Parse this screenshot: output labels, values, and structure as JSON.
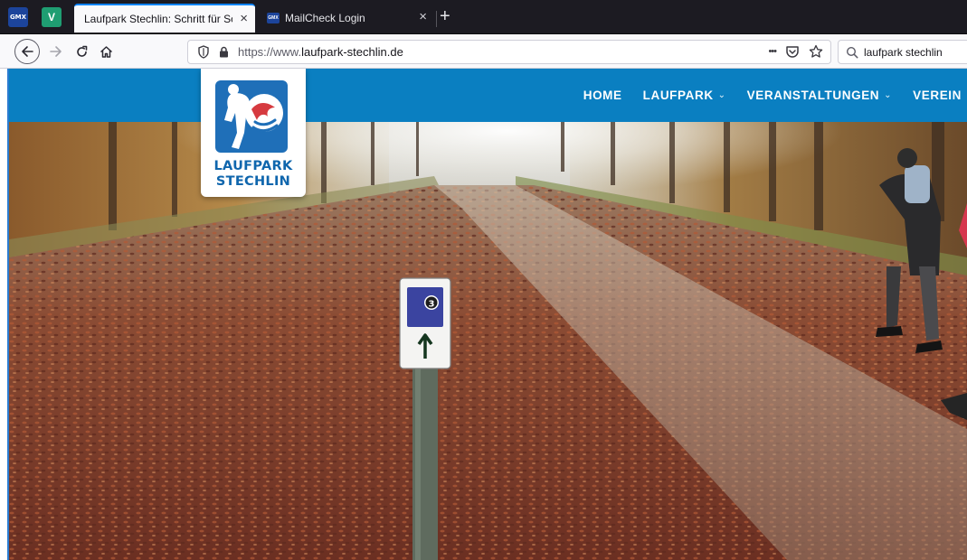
{
  "browser": {
    "pinned_tabs": [
      {
        "icon": "gmx-icon",
        "label": "GMX"
      },
      {
        "icon": "v-app-icon",
        "label": "V"
      }
    ],
    "tabs": [
      {
        "title": "Laufpark Stechlin: Schritt für Schritt",
        "active": true
      },
      {
        "title": "MailCheck Login",
        "favicon_label": "GMX",
        "active": false
      }
    ],
    "new_tab_label": "+",
    "url": {
      "scheme": "https://www.",
      "host": "laufpark-stechlin.de"
    },
    "url_actions": {
      "more": "•••"
    },
    "search_value": "laufpark stechlin"
  },
  "site": {
    "brand_color": "#0a7fc1",
    "logo": {
      "line1": "LAUFPARK",
      "line2": "STECHLIN"
    },
    "menu": [
      {
        "label": "HOME",
        "has_dropdown": false
      },
      {
        "label": "LAUFPARK",
        "has_dropdown": true
      },
      {
        "label": "VERANSTALTUNGEN",
        "has_dropdown": true
      },
      {
        "label": "VEREIN",
        "has_dropdown": true
      }
    ],
    "caret": "⌄",
    "hero": {
      "marker_number": "3",
      "marker_label": "LAUFPARK STECHLIN"
    }
  }
}
